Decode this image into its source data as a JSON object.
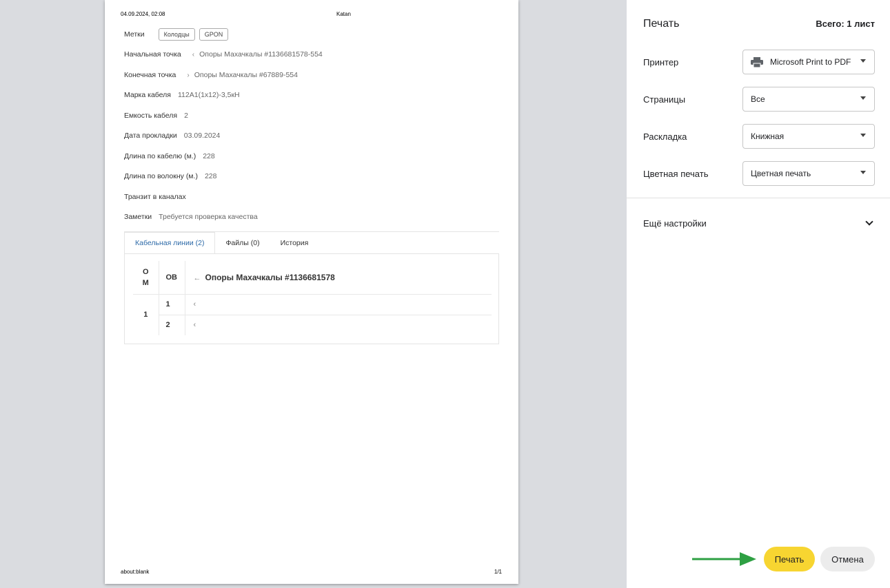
{
  "preview": {
    "header_date": "04.09.2024, 02:08",
    "header_title": "Katan",
    "footer_url": "about:blank",
    "footer_page": "1/1",
    "tags_label": "Метки",
    "tags": [
      "Колодцы",
      "GPON"
    ],
    "start_label": "Начальная точка",
    "start_value": "Опоры Махачкалы #1136681578-554",
    "end_label": "Конечная точка",
    "end_value": "Опоры Махачкалы #67889-554",
    "brand_label": "Марка кабеля",
    "brand_value": "112А1(1х12)-3,5кН",
    "capacity_label": "Емкость кабеля",
    "capacity_value": "2",
    "date_label": "Дата прокладки",
    "date_value": "03.09.2024",
    "cable_len_label": "Длина по кабелю (м.)",
    "cable_len_value": "228",
    "fiber_len_label": "Длина по волокну (м.)",
    "fiber_len_value": "228",
    "transit_label": "Транзит в каналах",
    "notes_label": "Заметки",
    "notes_value": "Требуется проверка качества",
    "tabs": [
      "Кабельная линии (2)",
      "Файлы (0)",
      "История"
    ],
    "table": {
      "om_header": "О М",
      "ov_header": "ОВ",
      "line_header": "Опоры Махачкалы #1136681578",
      "om_value": "1",
      "rows": [
        "1",
        "2"
      ]
    }
  },
  "panel": {
    "title": "Печать",
    "total": "Всего: 1 лист",
    "printer_label": "Принтер",
    "printer_value": "Microsoft Print to PDF",
    "pages_label": "Страницы",
    "pages_value": "Все",
    "layout_label": "Раскладка",
    "layout_value": "Книжная",
    "color_label": "Цветная печать",
    "color_value": "Цветная печать",
    "more_settings": "Ещё настройки",
    "print_button": "Печать",
    "cancel_button": "Отмена"
  },
  "colors": {
    "accent_button": "#f7d531",
    "annotation_arrow": "#2ea043",
    "active_tab": "#2d6aa8"
  }
}
